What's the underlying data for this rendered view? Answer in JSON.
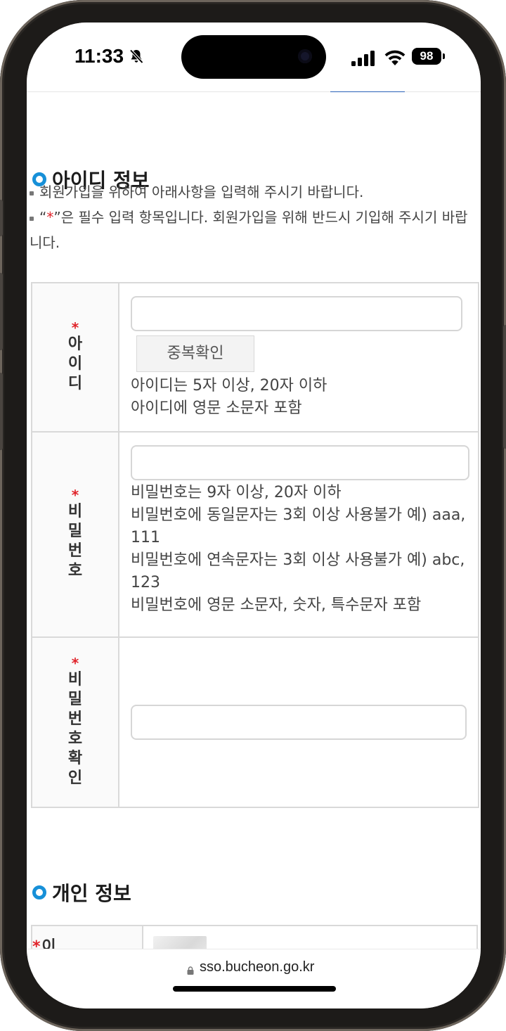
{
  "status_bar": {
    "time": "11:33",
    "battery": "98"
  },
  "browser": {
    "url": "sso.bucheon.go.kr"
  },
  "id_section": {
    "title": "아이디 정보",
    "notes": [
      "회원가입을 위하여 아래사항을 입력해 주시기 바랍니다.",
      "”은 필수 입력 항목입니다. 회원가입을 위해 반드시 기입해 주시기 바랍니다."
    ],
    "note_open_quote": "“",
    "note_star": "*",
    "required_star": "*",
    "rows": {
      "id": {
        "label": "아이디",
        "dup_button": "중복확인",
        "hints": [
          "아이디는 5자 이상, 20자 이하",
          "아이디에 영문 소문자 포함"
        ]
      },
      "password": {
        "label": "비밀번호",
        "hints": [
          "비밀번호는 9자 이상, 20자 이하",
          "비밀번호에 동일문자는 3회 이상 사용불가 예) aaa, 111",
          "비밀번호에 연속문자는 3회 이상 사용불가 예) abc, 123",
          "비밀번호에 영문 소문자, 숫자, 특수문자 포함"
        ]
      },
      "password_confirm": {
        "label": "비밀번호확인"
      }
    }
  },
  "personal_section": {
    "title": "개인 정보",
    "rows": {
      "name": {
        "label": "이름"
      }
    }
  }
}
